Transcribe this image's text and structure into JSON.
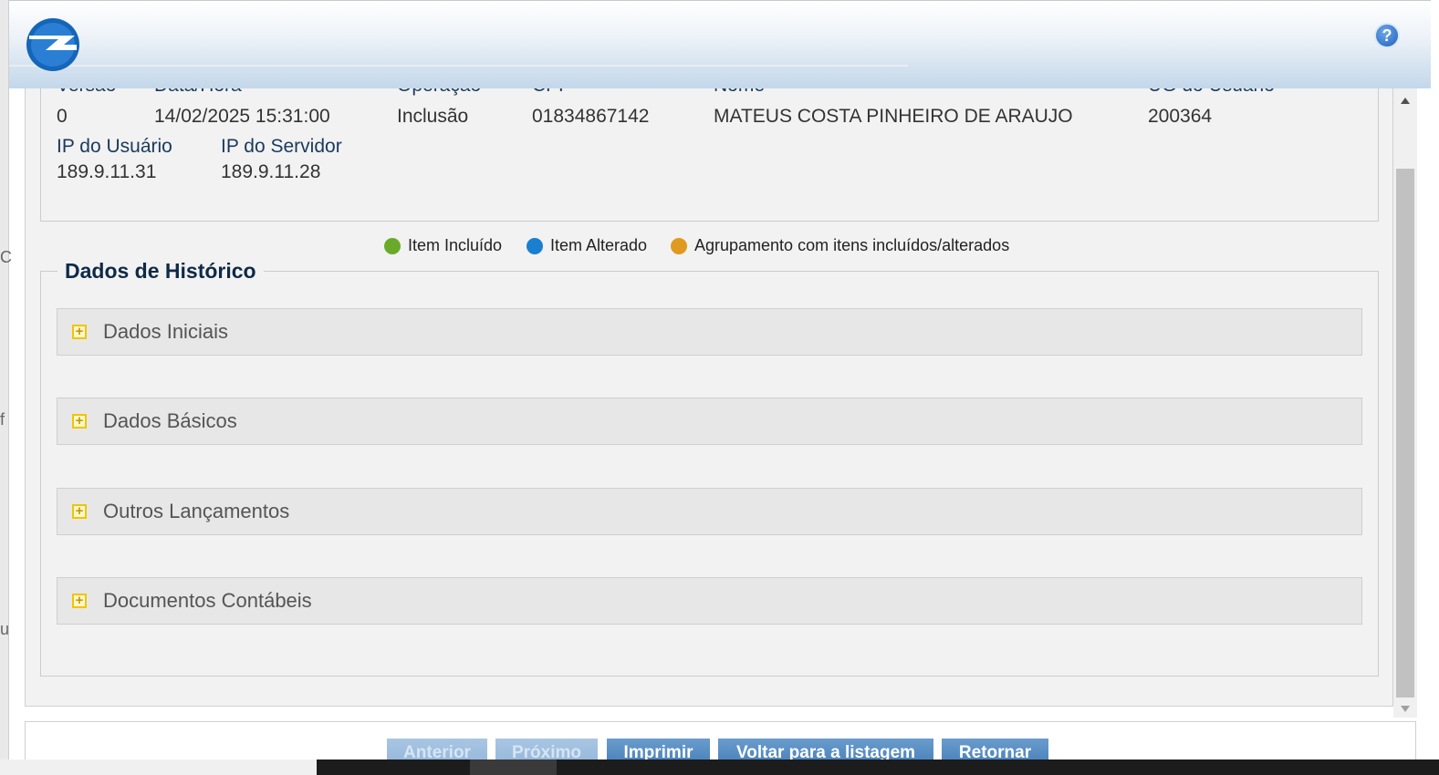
{
  "header": {
    "help_icon": "?"
  },
  "info": {
    "versao": {
      "label": "Versão",
      "value": "0"
    },
    "data_hora": {
      "label": "Data/Hora",
      "value": "14/02/2025 15:31:00"
    },
    "operacao": {
      "label": "Operação",
      "value": "Inclusão"
    },
    "cpf": {
      "label": "CPF",
      "value": "01834867142"
    },
    "nome": {
      "label": "Nome",
      "value": "MATEUS COSTA PINHEIRO DE ARAUJO"
    },
    "ug_usuario": {
      "label": "UG do Usuário",
      "value": "200364"
    },
    "ip_usuario": {
      "label": "IP do Usuário",
      "value": "189.9.11.31"
    },
    "ip_servidor": {
      "label": "IP do Servidor",
      "value": "189.9.11.28"
    }
  },
  "legend": [
    {
      "label": "Item Incluído",
      "color": "#6aaa2a"
    },
    {
      "label": "Item Alterado",
      "color": "#1a7fd0"
    },
    {
      "label": "Agrupamento com itens incluídos/alterados",
      "color": "#e09a20"
    }
  ],
  "historico": {
    "title": "Dados de Histórico",
    "sections": [
      {
        "label": "Dados Iniciais"
      },
      {
        "label": "Dados Básicos"
      },
      {
        "label": "Outros Lançamentos"
      },
      {
        "label": "Documentos Contábeis"
      }
    ]
  },
  "footer": {
    "anterior": "Anterior",
    "proximo": "Próximo",
    "imprimir": "Imprimir",
    "voltar": "Voltar para a listagem",
    "retornar": "Retornar"
  },
  "left_fragments": [
    "C",
    "f",
    "u"
  ]
}
